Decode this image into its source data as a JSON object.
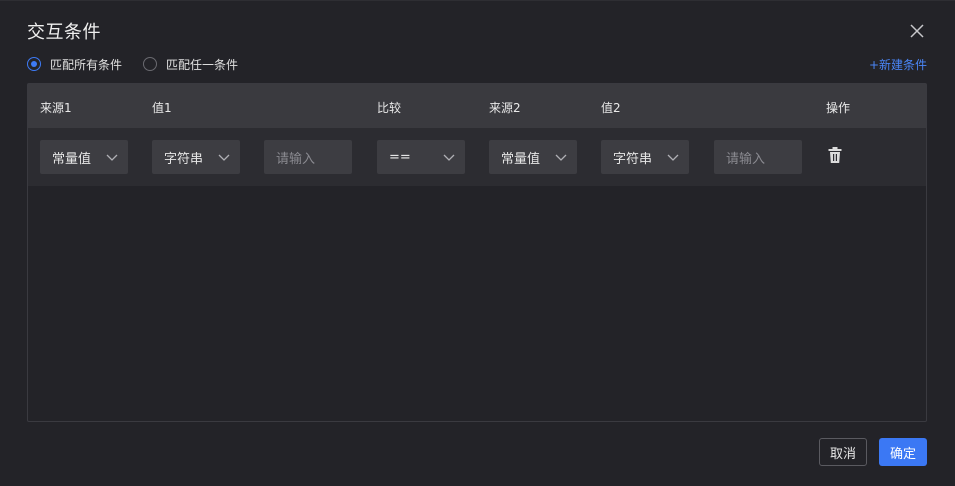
{
  "dialog": {
    "title": "交互条件"
  },
  "match_mode": {
    "options": [
      {
        "label": "匹配所有条件",
        "checked": true
      },
      {
        "label": "匹配任一条件",
        "checked": false
      }
    ]
  },
  "new_condition_label": "+新建条件",
  "table": {
    "headers": {
      "source1": "来源1",
      "value1": "值1",
      "compare": "比较",
      "source2": "来源2",
      "value2": "值2",
      "actions": "操作"
    },
    "rows": [
      {
        "source1": "常量值",
        "value1_type": "字符串",
        "value1_placeholder": "请输入",
        "compare": "==",
        "source2": "常量值",
        "value2_type": "字符串",
        "value2_placeholder": "请输入"
      }
    ]
  },
  "footer": {
    "cancel_label": "取消",
    "ok_label": "确定"
  },
  "colors": {
    "accent": "#3b78f4",
    "background": "#232328",
    "header": "#3a3a3f"
  },
  "icons": [
    "close-icon",
    "chevron-down-icon",
    "trash-icon"
  ]
}
